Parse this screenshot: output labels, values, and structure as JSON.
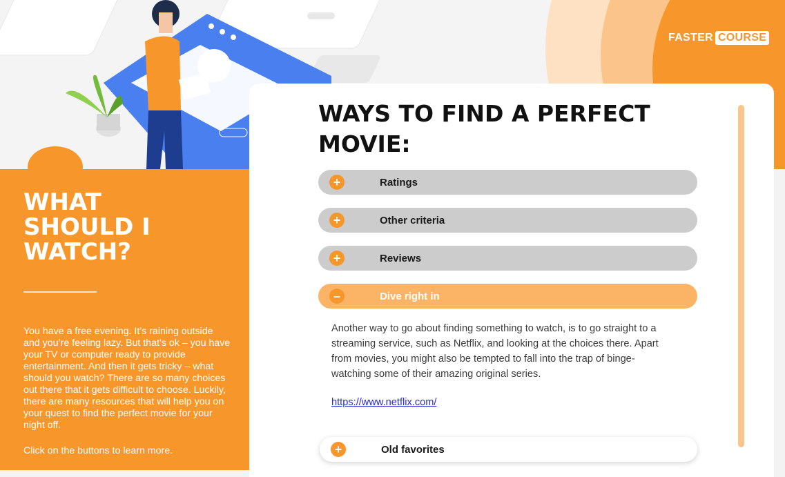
{
  "brand": {
    "part1": "FASTER",
    "part2": "COURSE"
  },
  "left_panel": {
    "title_lines": [
      "WHAT",
      "SHOULD I",
      "WATCH?"
    ],
    "body": "You have a free evening. It’s raining outside and you’re feeling lazy. But that’s ok – you have your TV or computer ready to provide entertainment. And then it gets tricky – what should you watch? There are so many choices out there that it gets difficult to choose. Luckily, there are many resources that will help you on your quest to find the perfect movie for your night off.",
    "cta": "Click on the buttons to learn more."
  },
  "card": {
    "title_lines": [
      "WAYS TO FIND A PERFECT",
      "MOVIE:"
    ],
    "accordion": [
      {
        "label": "Ratings",
        "state": "collapsed",
        "icon": "+"
      },
      {
        "label": "Other criteria",
        "state": "collapsed",
        "icon": "+"
      },
      {
        "label": "Reviews",
        "state": "collapsed",
        "icon": "+"
      },
      {
        "label": "Dive right in",
        "state": "expanded",
        "icon": "–"
      },
      {
        "label": "Old favorites",
        "state": "collapsed",
        "icon": "+"
      }
    ],
    "expanded_text": "Another way to go about finding something to watch, is to go straight to a streaming service, such as Netflix, and looking at the choices there. Apart from movies, you might also be tempted to fall into the trap of binge-watching some of their amazing original series.",
    "expanded_link": "https://www.netflix.com/"
  },
  "colors": {
    "accent": "#f7972b",
    "accent_light": "#fbb365",
    "collapsed_bg": "#cccccc"
  }
}
